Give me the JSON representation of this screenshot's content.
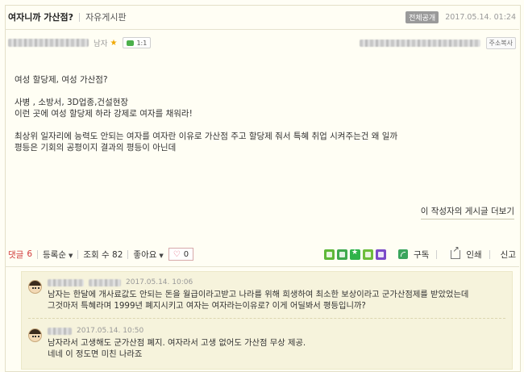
{
  "post": {
    "title": "여자니까 가산점?",
    "board": "자유게시판",
    "visibility_badge": "전체공개",
    "date": "2017.05.14. 01:24",
    "author_gender": "남자",
    "chat_label": "1:1",
    "address_button": "주소복사",
    "body_lines": [
      "여성 할당제, 여성 가산점?",
      "",
      "사병 , 소방서, 3D업종,건설현장",
      "이런 곳에 여성 할당제 하라  강제로 여자를 채워라!",
      "",
      "최상위 일자리에 능력도 안되는 여자를 여자란 이유로 가산점 주고 할당제 줘서 특혜 취업 시켜주는건 왜 일까",
      "평등은 기회의 공평이지 결과의 평등이 아닌데"
    ],
    "more_link": "이 작성자의 게시글 더보기"
  },
  "actions": {
    "comment_label": "댓글",
    "comment_count": "6",
    "sort_label": "등록순",
    "views_label": "조회 수 82",
    "like_label": "좋아요",
    "like_count": "0",
    "subscribe": "구독",
    "print": "인쇄",
    "report": "신고"
  },
  "share_colors": [
    "#5fb838",
    "#3fa94e",
    "#2fb34a",
    "#6dbd3c",
    "#7b4bc8"
  ],
  "comments": [
    {
      "date": "2017.05.14. 10:06",
      "lines": [
        "남자는 한달에 개사료값도 안되는 돈을 월급이라고받고 나라를 위해 희생하여 최소한 보상이라고 군가산점제를 받았었는데",
        "그것마저 특혜라며 1999년 폐지시키고 여자는 여자라는이유로? 이게 어딜봐서 평등입니까?"
      ]
    },
    {
      "date": "2017.05.14. 10:50",
      "lines": [
        "남자라서 고생해도 군가산점 폐지. 여자라서 고생 없어도 가산점 무상 제공.",
        "네네 이 정도면 미친 나라죠"
      ]
    }
  ]
}
